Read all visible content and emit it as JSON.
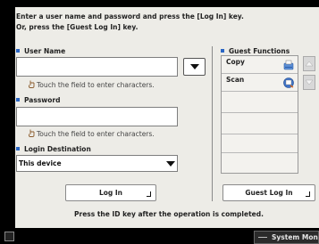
{
  "instructions": {
    "line1": "Enter a user name and password and press the [Log In] key.",
    "line2": "Or, press the [Guest Log In] key."
  },
  "user_name": {
    "label": "User Name",
    "value": "",
    "hint": "Touch the field to enter characters."
  },
  "password": {
    "label": "Password",
    "value": "",
    "hint": "Touch the field to enter characters."
  },
  "login_destination": {
    "label": "Login Destination",
    "selected": "This device"
  },
  "buttons": {
    "login": "Log In",
    "guest_login": "Guest Log In"
  },
  "guest_functions": {
    "label": "Guest Functions",
    "items": [
      {
        "label": "Copy",
        "icon": "copy-icon"
      },
      {
        "label": "Scan",
        "icon": "scan-icon"
      }
    ]
  },
  "footer": {
    "message": "Press the ID key after the operation is completed."
  },
  "status_bar": {
    "system_monitor": "System Monitor"
  },
  "colors": {
    "accent": "#2a66c4",
    "panel_bg": "#edece7",
    "screen_bg": "#000000"
  }
}
